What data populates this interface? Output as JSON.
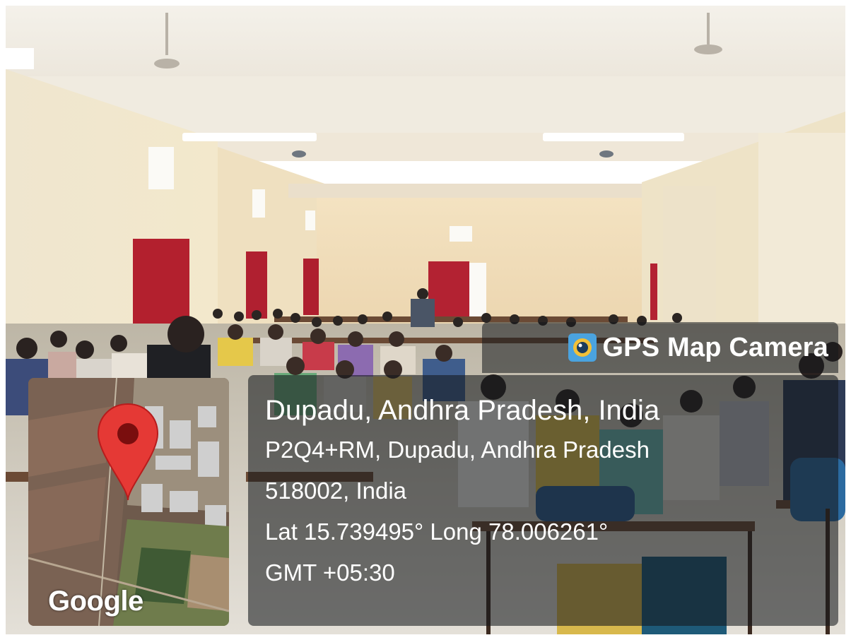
{
  "photo": {
    "description_icon": "classroom-photo"
  },
  "overlay": {
    "app_name": "GPS Map Camera",
    "app_icon": "camera-lens-icon",
    "location_title": "Dupadu, Andhra Pradesh, India",
    "address_line_1": "P2Q4+RM, Dupadu, Andhra Pradesh",
    "address_line_2": "518002, India",
    "coordinates": "Lat 15.739495° Long 78.006261°",
    "timezone": "GMT +05:30"
  },
  "map": {
    "provider_label": "Google",
    "pin_icon": "map-pin-icon",
    "pin_color": "#e53935"
  },
  "colors": {
    "wall": "#efe3c4",
    "ceiling": "#f3efe6",
    "curtain": "#b3202e",
    "floor": "#d9d4c8"
  }
}
